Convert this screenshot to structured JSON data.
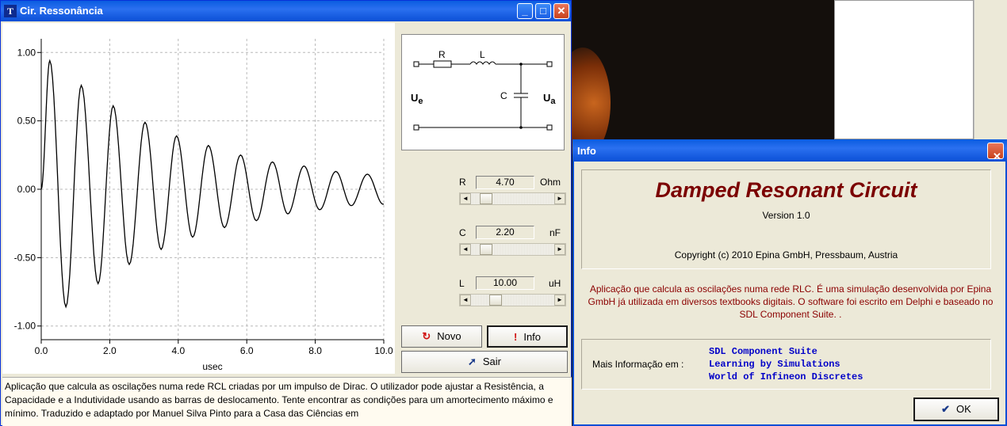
{
  "window": {
    "title": "Cir. Ressonância",
    "icon_letter": "T"
  },
  "chart_data": {
    "type": "line",
    "xlabel": "usec",
    "xlim": [
      0,
      10
    ],
    "ylim": [
      -1.1,
      1.1
    ],
    "xticks": [
      "0.0",
      "2.0",
      "4.0",
      "6.0",
      "8.0",
      "10.0"
    ],
    "yticks": [
      "1.00",
      "0.50",
      "0.00",
      "-0.50",
      "-1.00"
    ],
    "grid": true,
    "peaks": [
      {
        "t": 0.25,
        "v": 0.94
      },
      {
        "t": 0.72,
        "v": -0.86
      },
      {
        "t": 1.17,
        "v": 0.76
      },
      {
        "t": 1.66,
        "v": -0.69
      },
      {
        "t": 2.1,
        "v": 0.61
      },
      {
        "t": 2.57,
        "v": -0.55
      },
      {
        "t": 3.03,
        "v": 0.49
      },
      {
        "t": 3.5,
        "v": -0.44
      },
      {
        "t": 3.95,
        "v": 0.39
      },
      {
        "t": 4.42,
        "v": -0.35
      },
      {
        "t": 4.88,
        "v": 0.32
      },
      {
        "t": 5.35,
        "v": -0.28
      },
      {
        "t": 5.82,
        "v": 0.25
      },
      {
        "t": 6.28,
        "v": -0.23
      },
      {
        "t": 6.75,
        "v": 0.2
      },
      {
        "t": 7.2,
        "v": -0.18
      },
      {
        "t": 7.67,
        "v": 0.17
      },
      {
        "t": 8.13,
        "v": -0.15
      },
      {
        "t": 8.6,
        "v": 0.13
      },
      {
        "t": 9.05,
        "v": -0.12
      },
      {
        "t": 9.52,
        "v": 0.11
      }
    ]
  },
  "circuit": {
    "R": "R",
    "L": "L",
    "C": "C",
    "Ue": "U",
    "Ue_sub": "e",
    "Ua": "U",
    "Ua_sub": "a"
  },
  "params": [
    {
      "label": "R",
      "value": "4.70",
      "unit": "Ohm",
      "slider": 0.12
    },
    {
      "label": "C",
      "value": "2.20",
      "unit": "nF",
      "slider": 0.12
    },
    {
      "label": "L",
      "value": "10.00",
      "unit": "uH",
      "slider": 0.25
    }
  ],
  "buttons": {
    "novo": "Novo",
    "info": "Info",
    "sair": "Sair"
  },
  "status_text": "Aplicação que calcula as oscilações numa rede RCL criadas por um impulso de Dirac.  O utilizador pode ajustar a Resistência, a Capacidade e a Indutividade usando as barras de deslocamento.  Tente encontrar as condições para um amortecimento máximo e mínimo. Traduzido e adaptado por Manuel Silva Pinto para a Casa das Ciências em",
  "dialog": {
    "title": "Info",
    "heading": "Damped Resonant Circuit",
    "version": "Version 1.0",
    "copyright": "Copyright (c) 2010 Epina GmbH, Pressbaum, Austria",
    "description": "Aplicação que calcula as oscilações numa rede RLC. É uma simulação desenvolvida por Epina GmbH já utilizada em diversos textbooks digitais. O software foi escrito em Delphi e baseado no SDL Component Suite.              .",
    "more_info_label": "Mais Informação em :",
    "links": [
      "SDL Component Suite",
      "Learning by Simulations",
      "World of Infineon Discretes"
    ],
    "ok_label": "OK"
  }
}
